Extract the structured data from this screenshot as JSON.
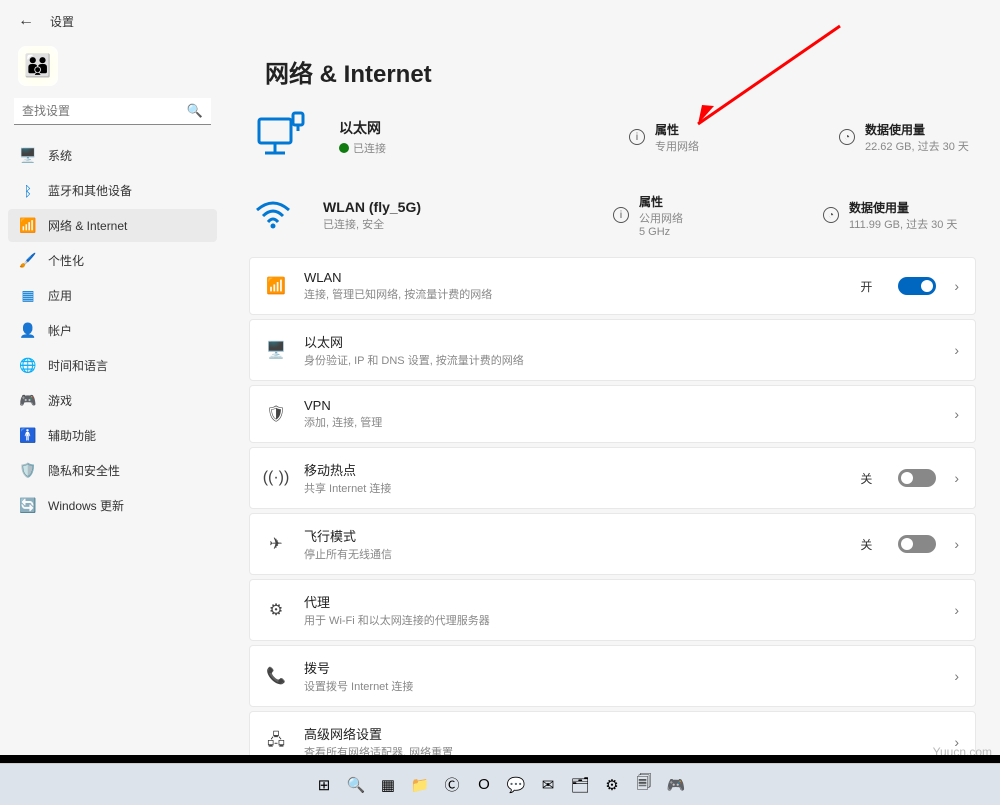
{
  "header": {
    "title": "设置"
  },
  "search": {
    "placeholder": "查找设置"
  },
  "sidebar": {
    "items": [
      {
        "label": "系统",
        "icon": "🖥️",
        "color": "#0078d4"
      },
      {
        "label": "蓝牙和其他设备",
        "icon": "ᛒ",
        "color": "#0078d4"
      },
      {
        "label": "网络 & Internet",
        "icon": "📶",
        "color": "#0078d4",
        "active": true
      },
      {
        "label": "个性化",
        "icon": "🖌️",
        "color": "#d13438"
      },
      {
        "label": "应用",
        "icon": "▦",
        "color": "#0078d4"
      },
      {
        "label": "帐户",
        "icon": "👤",
        "color": "#ff8c00"
      },
      {
        "label": "时间和语言",
        "icon": "🌐",
        "color": "#0078d4"
      },
      {
        "label": "游戏",
        "icon": "🎮",
        "color": "#777"
      },
      {
        "label": "辅助功能",
        "icon": "🚹",
        "color": "#0078d4"
      },
      {
        "label": "隐私和安全性",
        "icon": "🛡️",
        "color": "#6b6b6b"
      },
      {
        "label": "Windows 更新",
        "icon": "🔄",
        "color": "#0099bc"
      }
    ]
  },
  "page": {
    "title": "网络 & Internet"
  },
  "ethernet": {
    "title": "以太网",
    "status": "已连接",
    "prop_label": "属性",
    "prop_sub": "专用网络",
    "usage_label": "数据使用量",
    "usage_sub": "22.62 GB, 过去 30 天"
  },
  "wlan": {
    "title": "WLAN (fly_5G)",
    "status": "已连接, 安全",
    "prop_label": "属性",
    "prop_sub": "公用网络",
    "prop_sub2": "5 GHz",
    "usage_label": "数据使用量",
    "usage_sub": "111.99 GB, 过去 30 天"
  },
  "cards": [
    {
      "id": "wlan",
      "title": "WLAN",
      "sub": "连接, 管理已知网络, 按流量计费的网络",
      "toggle": {
        "state": "on",
        "label": "开"
      }
    },
    {
      "id": "ethernet",
      "title": "以太网",
      "sub": "身份验证, IP 和 DNS 设置, 按流量计费的网络"
    },
    {
      "id": "vpn",
      "title": "VPN",
      "sub": "添加, 连接, 管理"
    },
    {
      "id": "hotspot",
      "title": "移动热点",
      "sub": "共享 Internet 连接",
      "toggle": {
        "state": "off",
        "label": "关"
      }
    },
    {
      "id": "airplane",
      "title": "飞行模式",
      "sub": "停止所有无线通信",
      "toggle": {
        "state": "off",
        "label": "关"
      }
    },
    {
      "id": "proxy",
      "title": "代理",
      "sub": "用于 Wi-Fi 和以太网连接的代理服务器"
    },
    {
      "id": "dialup",
      "title": "拨号",
      "sub": "设置拨号 Internet 连接"
    },
    {
      "id": "advanced",
      "title": "高级网络设置",
      "sub": "查看所有网络适配器, 网络重置"
    }
  ],
  "card_icons": {
    "wlan": "📶",
    "ethernet": "🖥️",
    "vpn": "🛡",
    "hotspot": "((·))",
    "airplane": "✈",
    "proxy": "⚙",
    "dialup": "📞",
    "advanced": "🖧"
  },
  "taskbar": [
    "⊞",
    "🔍",
    "▦",
    "📁",
    "Ⓒ",
    "O",
    "💬",
    "✉",
    "🗂",
    "⚙",
    "🗐",
    "🎮"
  ],
  "watermark": "Yuucn.com"
}
